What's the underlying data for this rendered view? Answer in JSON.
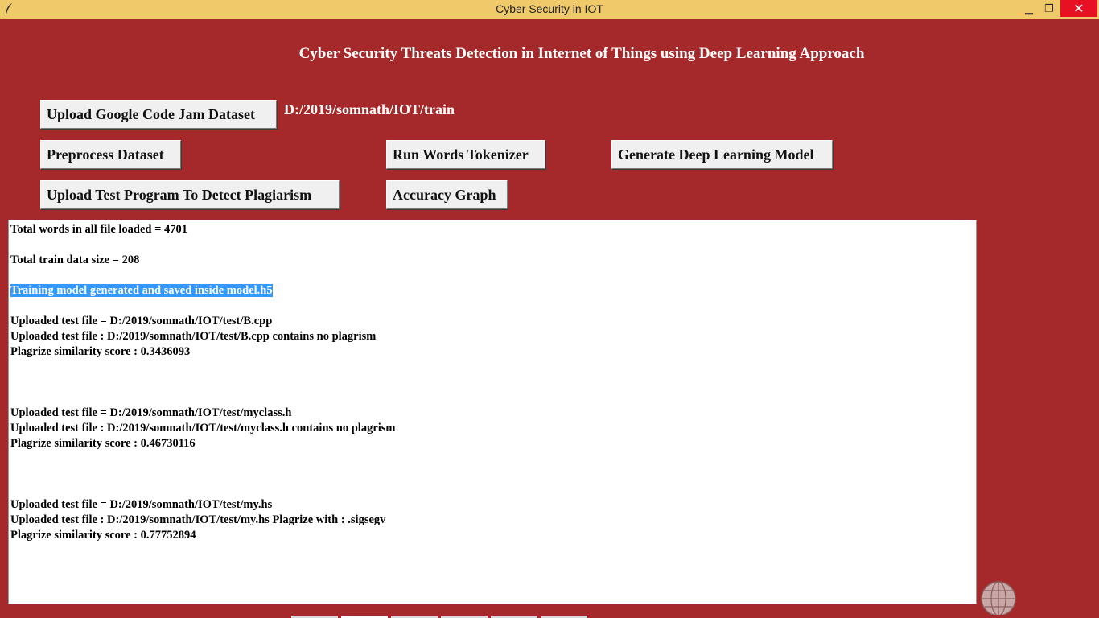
{
  "window": {
    "title": "Cyber Security in IOT",
    "controls": {
      "minimize": "▁",
      "restore": "❐",
      "close": "✕"
    }
  },
  "heading": "Cyber Security Threats Detection in Internet of Things using Deep Learning Approach",
  "buttons": {
    "upload_dataset": "Upload Google Code Jam Dataset",
    "preprocess": "Preprocess Dataset",
    "tokenizer": "Run Words Tokenizer",
    "generate_model": "Generate Deep Learning Model",
    "upload_test": "Upload Test Program To Detect Plagiarism",
    "accuracy_graph": "Accuracy Graph"
  },
  "dataset_path": "D:/2019/somnath/IOT/train",
  "output": {
    "lines": [
      "Total words in all file loaded = 4701",
      "",
      "Total train data size = 208",
      "",
      "Training model generated and saved inside model.h5",
      "",
      "Uploaded test file = D:/2019/somnath/IOT/test/B.cpp",
      "Uploaded test file : D:/2019/somnath/IOT/test/B.cpp contains no plagrism",
      "Plagrize similarity score : 0.3436093",
      "",
      "",
      "",
      "Uploaded test file = D:/2019/somnath/IOT/test/myclass.h",
      "Uploaded test file : D:/2019/somnath/IOT/test/myclass.h contains no plagrism",
      "Plagrize similarity score : 0.46730116",
      "",
      "",
      "",
      "Uploaded test file = D:/2019/somnath/IOT/test/my.hs",
      "Uploaded test file : D:/2019/somnath/IOT/test/my.hs Plagrize with : .sigsegv",
      "Plagrize similarity score : 0.77752894"
    ],
    "selected_line": 4
  },
  "colors": {
    "background": "#a5292a",
    "titlebar": "#f0c96a",
    "selection": "#3399ff"
  },
  "icons": [
    "feather-icon",
    "globe-icon"
  ]
}
